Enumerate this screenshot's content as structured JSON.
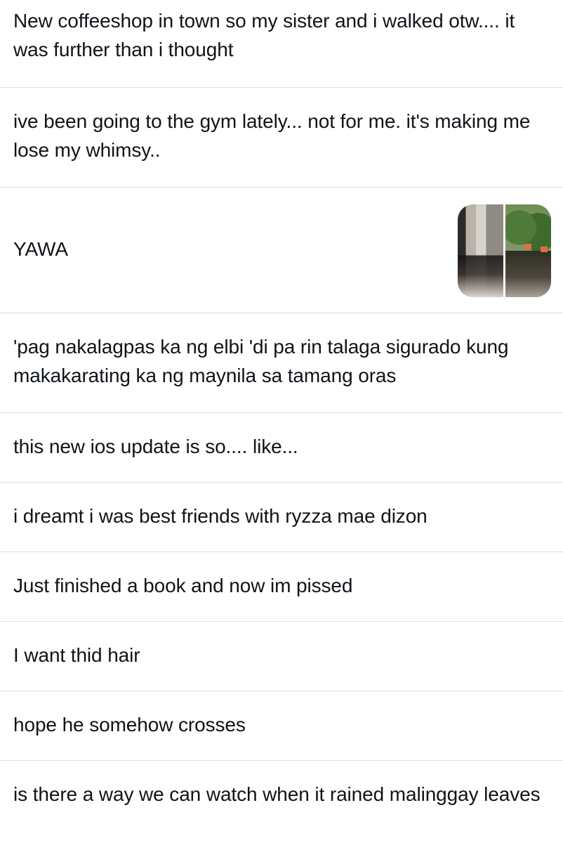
{
  "feed": {
    "posts": [
      {
        "text": "New coffeeshop in town so my sister and i walked otw.... it was further than i thought"
      },
      {
        "text": "ive been going to the gym lately... not for me. it's making me lose my whimsy.."
      },
      {
        "text": "YAWA",
        "media": {
          "type": "photo-pair",
          "description_icon": "image-thumbnail"
        }
      },
      {
        "text": "'pag nakalagpas ka ng elbi 'di pa rin talaga sigurado kung makakarating ka ng maynila sa tamang oras"
      },
      {
        "text": "this new ios update is so.... like..."
      },
      {
        "text": "i dreamt i was best friends with ryzza mae dizon"
      },
      {
        "text": "Just finished a book and now im pissed"
      },
      {
        "text": "I want thid hair"
      },
      {
        "text": "hope he somehow crosses"
      },
      {
        "text": "is there a way we can watch when it rained malinggay leaves"
      }
    ]
  },
  "colors": {
    "text": "#0f1419",
    "divider": "#dcdfe2",
    "background": "#ffffff"
  }
}
